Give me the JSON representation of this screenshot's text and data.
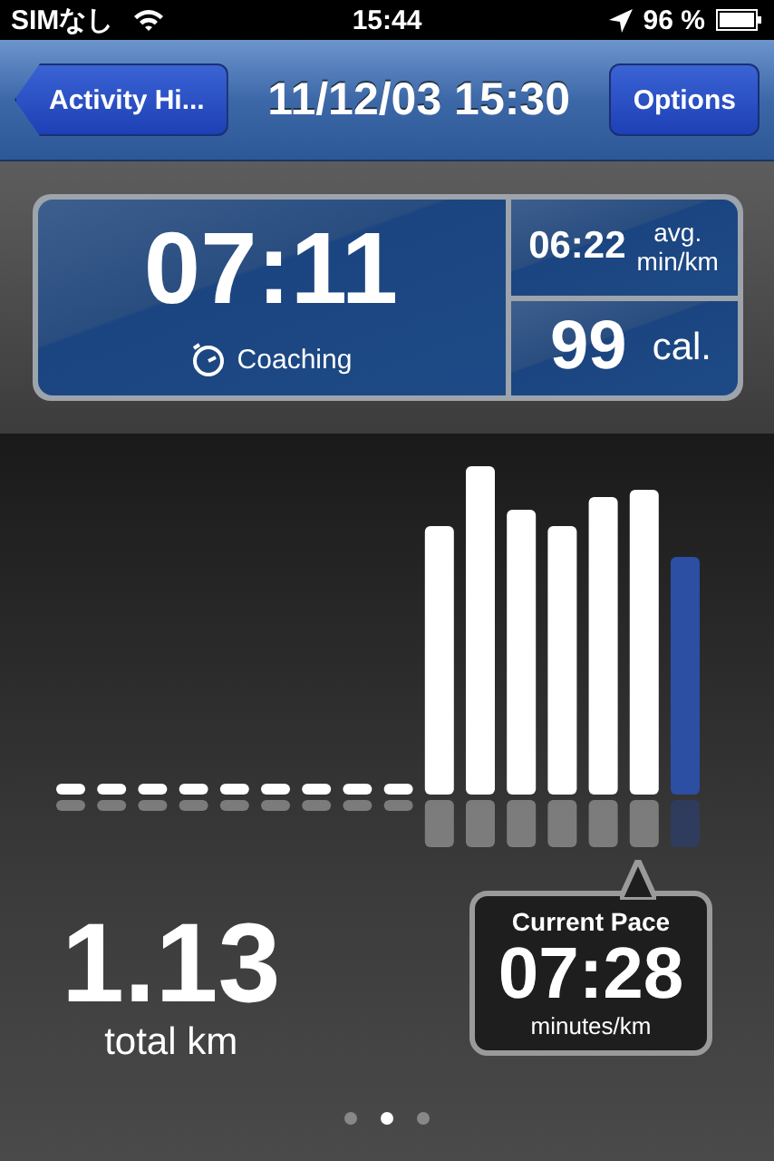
{
  "status_bar": {
    "carrier": "SIMなし",
    "time": "15:44",
    "battery": "96 %"
  },
  "nav_bar": {
    "back_button": "Activity Hi...",
    "title": "11/12/03 15:30",
    "options_button": "Options"
  },
  "summary": {
    "duration": "07:11",
    "coaching": "Coaching",
    "avg_pace": "06:22",
    "avg_label": "avg.",
    "avg_unit": "min/km",
    "calories": "99",
    "calories_unit": "cal."
  },
  "distance": {
    "value": "1.13",
    "label": "total km"
  },
  "current_pace": {
    "title": "Current Pace",
    "value": "07:28",
    "unit": "minutes/km"
  },
  "page_dots": [
    {
      "selected": false
    },
    {
      "selected": true
    },
    {
      "selected": false
    }
  ]
}
